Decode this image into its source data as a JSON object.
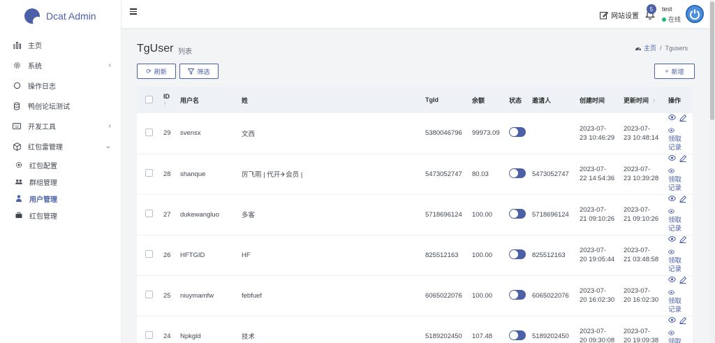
{
  "brand": {
    "name": "Dcat Admin"
  },
  "sidebar": {
    "items": [
      {
        "label": "主页",
        "icon": "bar-chart-icon"
      },
      {
        "label": "系统",
        "icon": "gear-icon",
        "has_children": true
      },
      {
        "label": "操作日志",
        "icon": "circle-icon"
      },
      {
        "label": "鸭创论坛测试",
        "icon": "coins-icon"
      },
      {
        "label": "开发工具",
        "icon": "keyboard-icon",
        "has_children": true
      },
      {
        "label": "红包雷管理",
        "icon": "cube-icon",
        "expanded": true
      }
    ],
    "sub_items": [
      {
        "label": "红包配置",
        "icon": "cog-icon"
      },
      {
        "label": "群组管理",
        "icon": "users-icon"
      },
      {
        "label": "用户管理",
        "icon": "user-icon",
        "active": true
      },
      {
        "label": "红包管理",
        "icon": "briefcase-icon"
      }
    ]
  },
  "topbar": {
    "site_setting": "网站设置",
    "notification_count": "5",
    "user_name": "test",
    "user_status": "在线"
  },
  "page": {
    "title": "TgUser",
    "subtitle": "列表",
    "breadcrumb_home": "主页",
    "breadcrumb_sep": "/",
    "breadcrumb_current": "Tgusers"
  },
  "toolbar": {
    "refresh_label": "刷新",
    "filter_label": "筛选",
    "add_label": "新增"
  },
  "table": {
    "headers": {
      "id": "ID",
      "username": "用户名",
      "surname": "姓",
      "tgid": "TgId",
      "balance": "余额",
      "status": "状态",
      "inviter": "邀请人",
      "created": "创建时间",
      "updated": "更新时间",
      "actions": "操作"
    },
    "action_record": "领取记录",
    "rows": [
      {
        "id": "29",
        "username": "svensx",
        "surname": "文西",
        "tgid": "5380046796",
        "balance": "99973.09",
        "inviter": "",
        "created_date": "2023-07-",
        "created_time": "23 10:46:29",
        "updated_date": "2023-07-",
        "updated_time": "23 10:48:14"
      },
      {
        "id": "28",
        "username": "shanque",
        "surname": "厉飞雨 | 代开✈会员 |",
        "tgid": "5473052747",
        "balance": "80.03",
        "inviter": "5473052747",
        "created_date": "2023-07-",
        "created_time": "22 14:54:36",
        "updated_date": "2023-07-",
        "updated_time": "23 10:39:28"
      },
      {
        "id": "27",
        "username": "dukewangluo",
        "surname": "多客",
        "tgid": "5718696124",
        "balance": "100.00",
        "inviter": "5718696124",
        "created_date": "2023-07-",
        "created_time": "21 09:10:26",
        "updated_date": "2023-07-",
        "updated_time": "21 09:10:26"
      },
      {
        "id": "26",
        "username": "HFTGID",
        "surname": "HF",
        "tgid": "825512163",
        "balance": "100.00",
        "inviter": "825512163",
        "created_date": "2023-07-",
        "created_time": "20 19:05:44",
        "updated_date": "2023-07-",
        "updated_time": "21 03:48:58"
      },
      {
        "id": "25",
        "username": "niuymamfw",
        "surname": "febfuef",
        "tgid": "6065022076",
        "balance": "100.00",
        "inviter": "6065022076",
        "created_date": "2023-07-",
        "created_time": "20 16:02:30",
        "updated_date": "2023-07-",
        "updated_time": "20 16:02:30"
      },
      {
        "id": "24",
        "username": "Npkgld",
        "surname": "技术",
        "tgid": "5189202450",
        "balance": "107.48",
        "inviter": "5189202450",
        "created_date": "2023-07-",
        "created_time": "20 09:30:08",
        "updated_date": "2023-07-",
        "updated_time": "20 19:09:38"
      }
    ]
  },
  "colors": {
    "primary": "#4c60a8",
    "online": "#21b978"
  }
}
